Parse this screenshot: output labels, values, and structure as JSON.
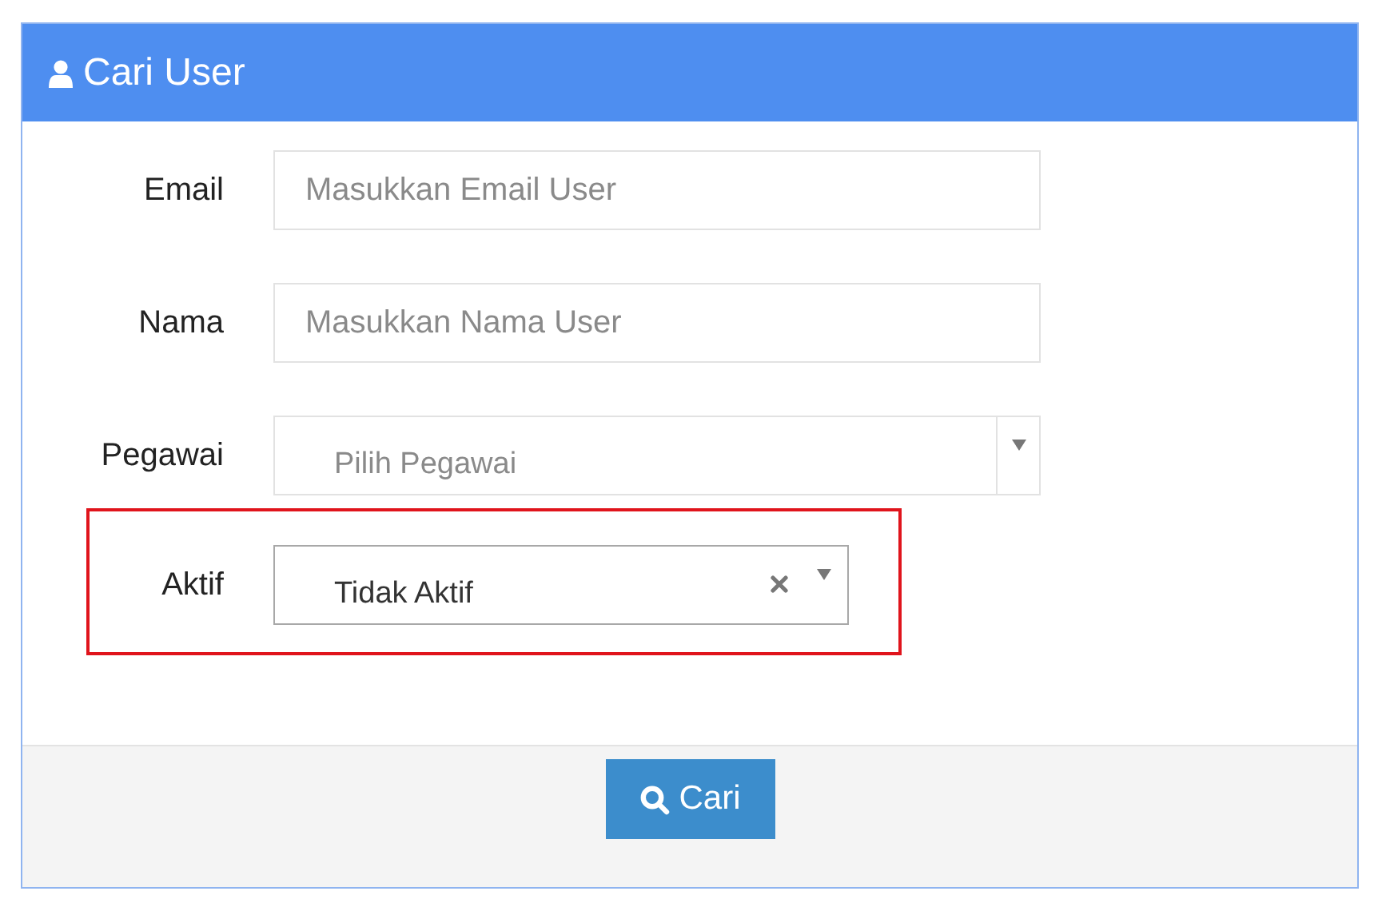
{
  "header": {
    "title": "Cari User"
  },
  "fields": [
    {
      "label": "Email",
      "kind": "text",
      "placeholder": "Masukkan Email User",
      "highlighted": false
    },
    {
      "label": "Nama",
      "kind": "text",
      "placeholder": "Masukkan Nama User",
      "highlighted": false
    },
    {
      "label": "Pegawai",
      "kind": "select",
      "placeholder": "Pilih Pegawai",
      "highlighted": false
    },
    {
      "label": "Aktif",
      "kind": "select",
      "value": "Tidak Aktif",
      "highlighted": true
    }
  ],
  "submit_button": {
    "label": "Cari"
  }
}
